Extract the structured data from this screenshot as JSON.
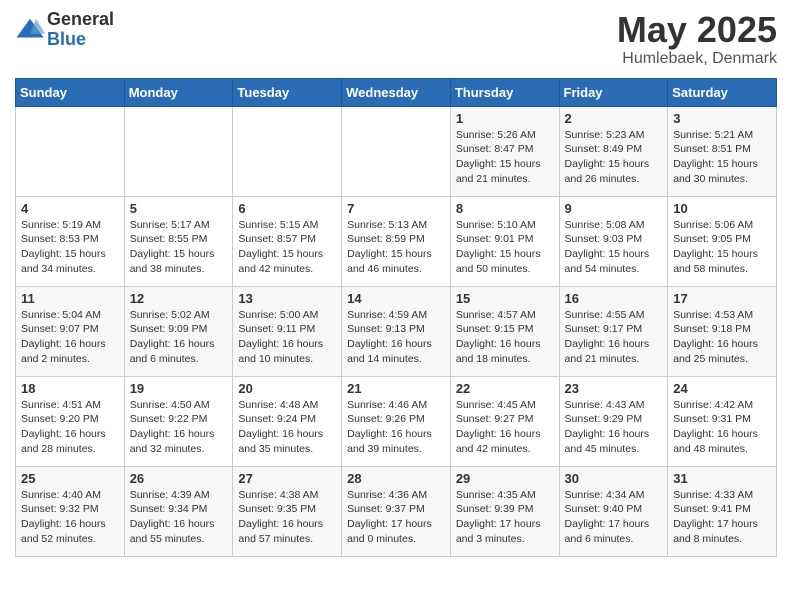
{
  "logo": {
    "general": "General",
    "blue": "Blue"
  },
  "title": {
    "month": "May 2025",
    "location": "Humlebaek, Denmark"
  },
  "calendar": {
    "headers": [
      "Sunday",
      "Monday",
      "Tuesday",
      "Wednesday",
      "Thursday",
      "Friday",
      "Saturday"
    ],
    "weeks": [
      [
        {
          "day": "",
          "info": ""
        },
        {
          "day": "",
          "info": ""
        },
        {
          "day": "",
          "info": ""
        },
        {
          "day": "",
          "info": ""
        },
        {
          "day": "1",
          "info": "Sunrise: 5:26 AM\nSunset: 8:47 PM\nDaylight: 15 hours\nand 21 minutes."
        },
        {
          "day": "2",
          "info": "Sunrise: 5:23 AM\nSunset: 8:49 PM\nDaylight: 15 hours\nand 26 minutes."
        },
        {
          "day": "3",
          "info": "Sunrise: 5:21 AM\nSunset: 8:51 PM\nDaylight: 15 hours\nand 30 minutes."
        }
      ],
      [
        {
          "day": "4",
          "info": "Sunrise: 5:19 AM\nSunset: 8:53 PM\nDaylight: 15 hours\nand 34 minutes."
        },
        {
          "day": "5",
          "info": "Sunrise: 5:17 AM\nSunset: 8:55 PM\nDaylight: 15 hours\nand 38 minutes."
        },
        {
          "day": "6",
          "info": "Sunrise: 5:15 AM\nSunset: 8:57 PM\nDaylight: 15 hours\nand 42 minutes."
        },
        {
          "day": "7",
          "info": "Sunrise: 5:13 AM\nSunset: 8:59 PM\nDaylight: 15 hours\nand 46 minutes."
        },
        {
          "day": "8",
          "info": "Sunrise: 5:10 AM\nSunset: 9:01 PM\nDaylight: 15 hours\nand 50 minutes."
        },
        {
          "day": "9",
          "info": "Sunrise: 5:08 AM\nSunset: 9:03 PM\nDaylight: 15 hours\nand 54 minutes."
        },
        {
          "day": "10",
          "info": "Sunrise: 5:06 AM\nSunset: 9:05 PM\nDaylight: 15 hours\nand 58 minutes."
        }
      ],
      [
        {
          "day": "11",
          "info": "Sunrise: 5:04 AM\nSunset: 9:07 PM\nDaylight: 16 hours\nand 2 minutes."
        },
        {
          "day": "12",
          "info": "Sunrise: 5:02 AM\nSunset: 9:09 PM\nDaylight: 16 hours\nand 6 minutes."
        },
        {
          "day": "13",
          "info": "Sunrise: 5:00 AM\nSunset: 9:11 PM\nDaylight: 16 hours\nand 10 minutes."
        },
        {
          "day": "14",
          "info": "Sunrise: 4:59 AM\nSunset: 9:13 PM\nDaylight: 16 hours\nand 14 minutes."
        },
        {
          "day": "15",
          "info": "Sunrise: 4:57 AM\nSunset: 9:15 PM\nDaylight: 16 hours\nand 18 minutes."
        },
        {
          "day": "16",
          "info": "Sunrise: 4:55 AM\nSunset: 9:17 PM\nDaylight: 16 hours\nand 21 minutes."
        },
        {
          "day": "17",
          "info": "Sunrise: 4:53 AM\nSunset: 9:18 PM\nDaylight: 16 hours\nand 25 minutes."
        }
      ],
      [
        {
          "day": "18",
          "info": "Sunrise: 4:51 AM\nSunset: 9:20 PM\nDaylight: 16 hours\nand 28 minutes."
        },
        {
          "day": "19",
          "info": "Sunrise: 4:50 AM\nSunset: 9:22 PM\nDaylight: 16 hours\nand 32 minutes."
        },
        {
          "day": "20",
          "info": "Sunrise: 4:48 AM\nSunset: 9:24 PM\nDaylight: 16 hours\nand 35 minutes."
        },
        {
          "day": "21",
          "info": "Sunrise: 4:46 AM\nSunset: 9:26 PM\nDaylight: 16 hours\nand 39 minutes."
        },
        {
          "day": "22",
          "info": "Sunrise: 4:45 AM\nSunset: 9:27 PM\nDaylight: 16 hours\nand 42 minutes."
        },
        {
          "day": "23",
          "info": "Sunrise: 4:43 AM\nSunset: 9:29 PM\nDaylight: 16 hours\nand 45 minutes."
        },
        {
          "day": "24",
          "info": "Sunrise: 4:42 AM\nSunset: 9:31 PM\nDaylight: 16 hours\nand 48 minutes."
        }
      ],
      [
        {
          "day": "25",
          "info": "Sunrise: 4:40 AM\nSunset: 9:32 PM\nDaylight: 16 hours\nand 52 minutes."
        },
        {
          "day": "26",
          "info": "Sunrise: 4:39 AM\nSunset: 9:34 PM\nDaylight: 16 hours\nand 55 minutes."
        },
        {
          "day": "27",
          "info": "Sunrise: 4:38 AM\nSunset: 9:35 PM\nDaylight: 16 hours\nand 57 minutes."
        },
        {
          "day": "28",
          "info": "Sunrise: 4:36 AM\nSunset: 9:37 PM\nDaylight: 17 hours\nand 0 minutes."
        },
        {
          "day": "29",
          "info": "Sunrise: 4:35 AM\nSunset: 9:39 PM\nDaylight: 17 hours\nand 3 minutes."
        },
        {
          "day": "30",
          "info": "Sunrise: 4:34 AM\nSunset: 9:40 PM\nDaylight: 17 hours\nand 6 minutes."
        },
        {
          "day": "31",
          "info": "Sunrise: 4:33 AM\nSunset: 9:41 PM\nDaylight: 17 hours\nand 8 minutes."
        }
      ]
    ]
  }
}
